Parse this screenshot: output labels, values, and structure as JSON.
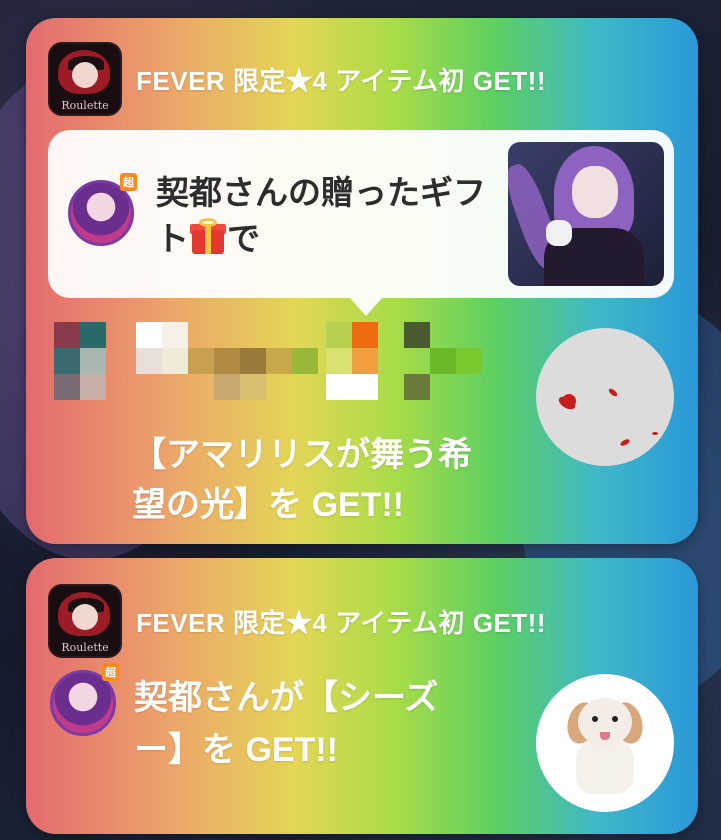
{
  "notifications": [
    {
      "app_icon_label": "Roulette",
      "title": "FEVER 限定★4 アイテム初 GET!!",
      "gift": {
        "line1": "契都さんの贈ったギフ",
        "line2_pre": "ト",
        "line2_post": "で",
        "gift_icon": "gift-box-icon",
        "avatar_tag": "超"
      },
      "item_text": "【アマリリスが舞う希望の光】を GET!!"
    },
    {
      "app_icon_label": "Roulette",
      "title": "FEVER 限定★4 アイテム初 GET!!",
      "avatar_tag": "超",
      "item_text": "契都さんが【シーズー】を GET!!"
    }
  ],
  "colors": {
    "gradient": [
      "#e36a6e",
      "#eca66a",
      "#e4d656",
      "#a8dc48",
      "#5dcf62",
      "#3fb8c8",
      "#2a98d8"
    ],
    "text_on_card": "#ffffff",
    "bubble_text": "#2d2d2d"
  }
}
